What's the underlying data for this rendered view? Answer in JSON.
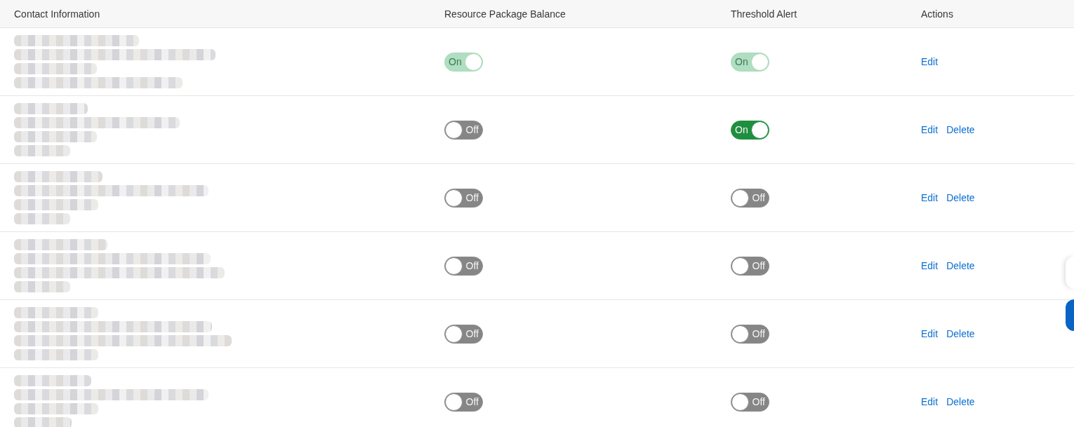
{
  "table": {
    "columns": [
      "Contact Information",
      "Resource Package Balance",
      "Threshold Alert",
      "Actions"
    ],
    "rows": [
      {
        "resource_package_balance": {
          "label": "On",
          "on": true,
          "disabled": true
        },
        "threshold_alert": {
          "label": "On",
          "on": true,
          "disabled": true
        },
        "actions": [
          "Edit"
        ]
      },
      {
        "resource_package_balance": {
          "label": "Off",
          "on": false,
          "disabled": false
        },
        "threshold_alert": {
          "label": "On",
          "on": true,
          "disabled": false
        },
        "actions": [
          "Edit",
          "Delete"
        ]
      },
      {
        "resource_package_balance": {
          "label": "Off",
          "on": false,
          "disabled": false
        },
        "threshold_alert": {
          "label": "Off",
          "on": false,
          "disabled": false
        },
        "actions": [
          "Edit",
          "Delete"
        ]
      },
      {
        "resource_package_balance": {
          "label": "Off",
          "on": false,
          "disabled": false
        },
        "threshold_alert": {
          "label": "Off",
          "on": false,
          "disabled": false
        },
        "actions": [
          "Edit",
          "Delete"
        ]
      },
      {
        "resource_package_balance": {
          "label": "Off",
          "on": false,
          "disabled": false
        },
        "threshold_alert": {
          "label": "Off",
          "on": false,
          "disabled": false
        },
        "actions": [
          "Edit",
          "Delete"
        ]
      },
      {
        "resource_package_balance": {
          "label": "Off",
          "on": false,
          "disabled": false
        },
        "threshold_alert": {
          "label": "Off",
          "on": false,
          "disabled": false
        },
        "actions": [
          "Edit",
          "Delete"
        ]
      }
    ]
  },
  "floating_buttons": [
    {
      "kind": "secondary"
    },
    {
      "kind": "primary"
    }
  ]
}
